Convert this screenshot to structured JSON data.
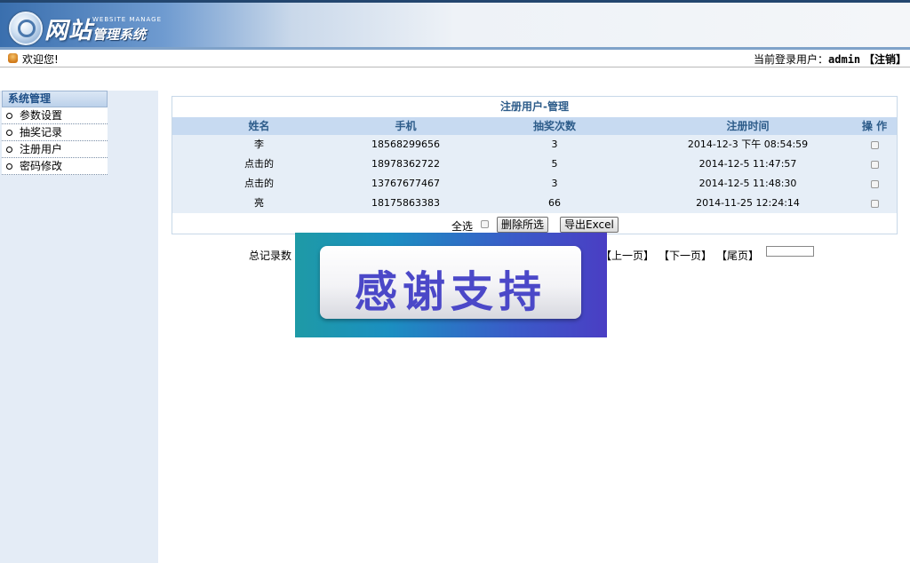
{
  "header": {
    "logo_main": "网站",
    "logo_small": "WEBSITE MANAGE",
    "logo_sub": "管理系统"
  },
  "userbar": {
    "welcome": "欢迎您!",
    "login_prefix": "当前登录用户：",
    "username": "admin",
    "logout": "【注销】"
  },
  "sidebar": {
    "title": "系统管理",
    "items": [
      {
        "label": "参数设置"
      },
      {
        "label": "抽奖记录"
      },
      {
        "label": "注册用户"
      },
      {
        "label": "密码修改"
      }
    ]
  },
  "panel": {
    "title": "注册用户-管理",
    "columns": [
      "姓名",
      "手机",
      "抽奖次数",
      "注册时间",
      "操 作"
    ],
    "rows": [
      {
        "name": "李",
        "phone": "18568299656",
        "count": "3",
        "time": "2014-12-3 下午 08:54:59"
      },
      {
        "name": "点击的",
        "phone": "18978362722",
        "count": "5",
        "time": "2014-12-5 11:47:57"
      },
      {
        "name": "点击的",
        "phone": "13767677467",
        "count": "3",
        "time": "2014-12-5 11:48:30"
      },
      {
        "name": "亮",
        "phone": "18175863383",
        "count": "66",
        "time": "2014-11-25 12:24:14"
      }
    ],
    "select_all": "全选",
    "delete_button": "删除所选",
    "export_button": "导出Excel"
  },
  "pager": {
    "total_label": "总记录数",
    "prev": "【上一页】",
    "next": "【下一页】",
    "last": "【尾页】",
    "page_input": ""
  },
  "overlay": {
    "text": "感谢支持"
  }
}
